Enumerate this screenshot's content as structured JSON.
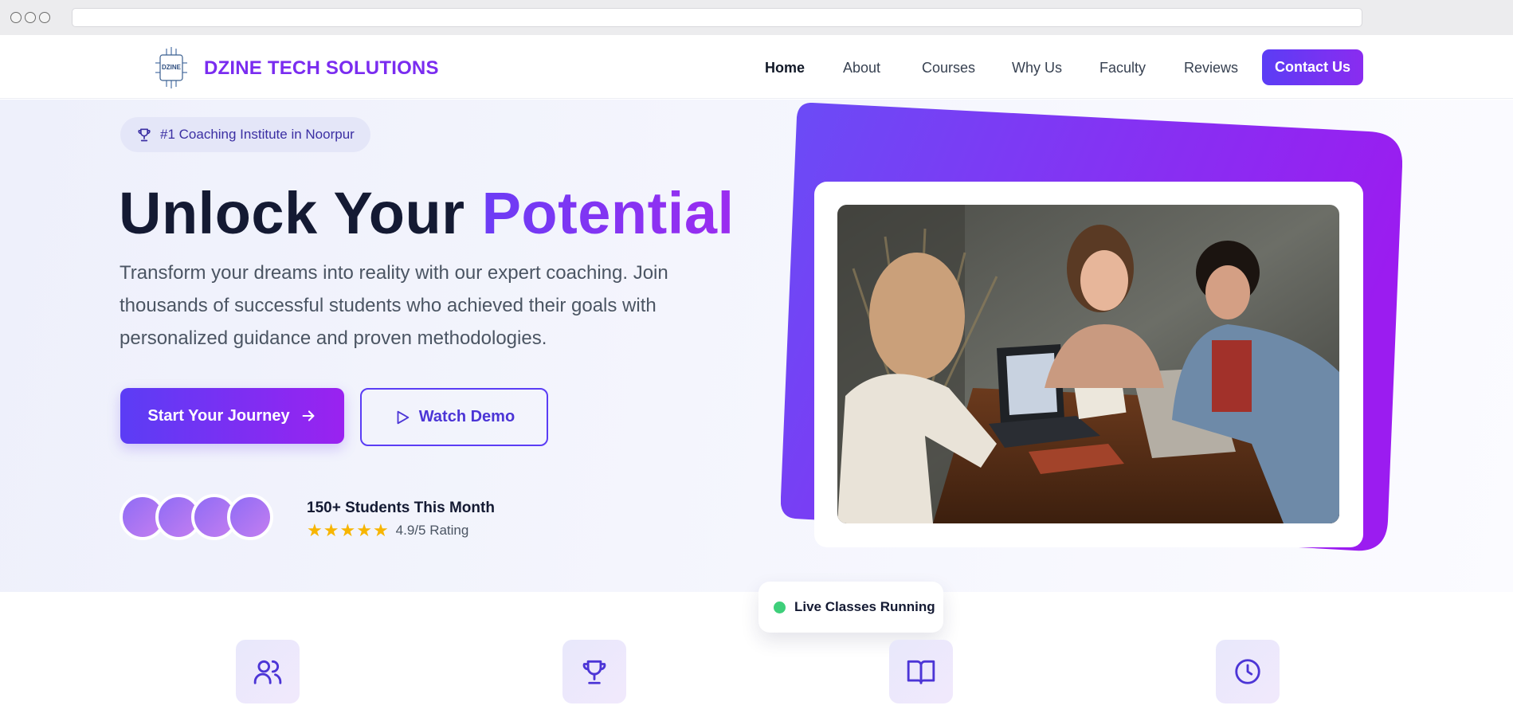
{
  "nav": {
    "brand": "DZINE TECH SOLUTIONS",
    "logo_text": "DZINE",
    "links": [
      "Home",
      "About",
      "Courses",
      "Why Us",
      "Faculty",
      "Reviews"
    ],
    "active": "Home",
    "cta": "Contact Us"
  },
  "hero": {
    "badge": "#1 Coaching Institute in Noorpur",
    "headline_main": "Unlock Your",
    "headline_accent": "Potential",
    "subtext": "Transform your dreams into reality with our expert coaching. Join thousands of successful students who achieved their goals with personalized guidance and proven methodologies.",
    "primary_button": "Start Your Journey",
    "secondary_button": "Watch Demo",
    "stats_title": "150+ Students This Month",
    "rating_stars": 5,
    "rating_text": "4.9/5 Rating",
    "live_badge": "Live Classes Running"
  },
  "features": {
    "icons": [
      "users-icon",
      "trophy-icon",
      "book-open-icon",
      "clock-icon"
    ]
  },
  "colors": {
    "brand_purple": "#7a2cf0",
    "primary_indigo": "#5b3df5",
    "live_green": "#3ecf7a",
    "star_yellow": "#f7b500"
  }
}
